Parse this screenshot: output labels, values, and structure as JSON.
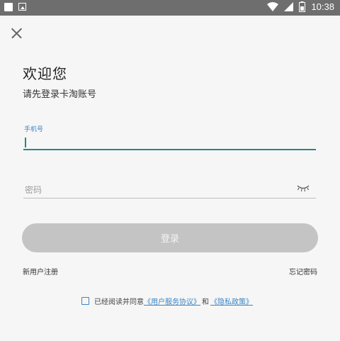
{
  "status_bar": {
    "time": "10:38"
  },
  "login": {
    "title": "欢迎您",
    "subtitle": "请先登录卡淘账号",
    "phone_label": "手机号",
    "phone_value": "",
    "password_placeholder": "密码",
    "login_button": "登录",
    "register_link": "新用户注册",
    "forgot_link": "忘记密码",
    "agreement_prefix": "已经阅读并同意",
    "user_agreement": "《用户服务协议》",
    "and_text": "和",
    "privacy_policy": "《隐私政策》"
  },
  "colors": {
    "accent": "#29877f",
    "link": "#3b86c5",
    "button_disabled": "#c4c4c4",
    "status_bar": "#6e6e6e"
  }
}
